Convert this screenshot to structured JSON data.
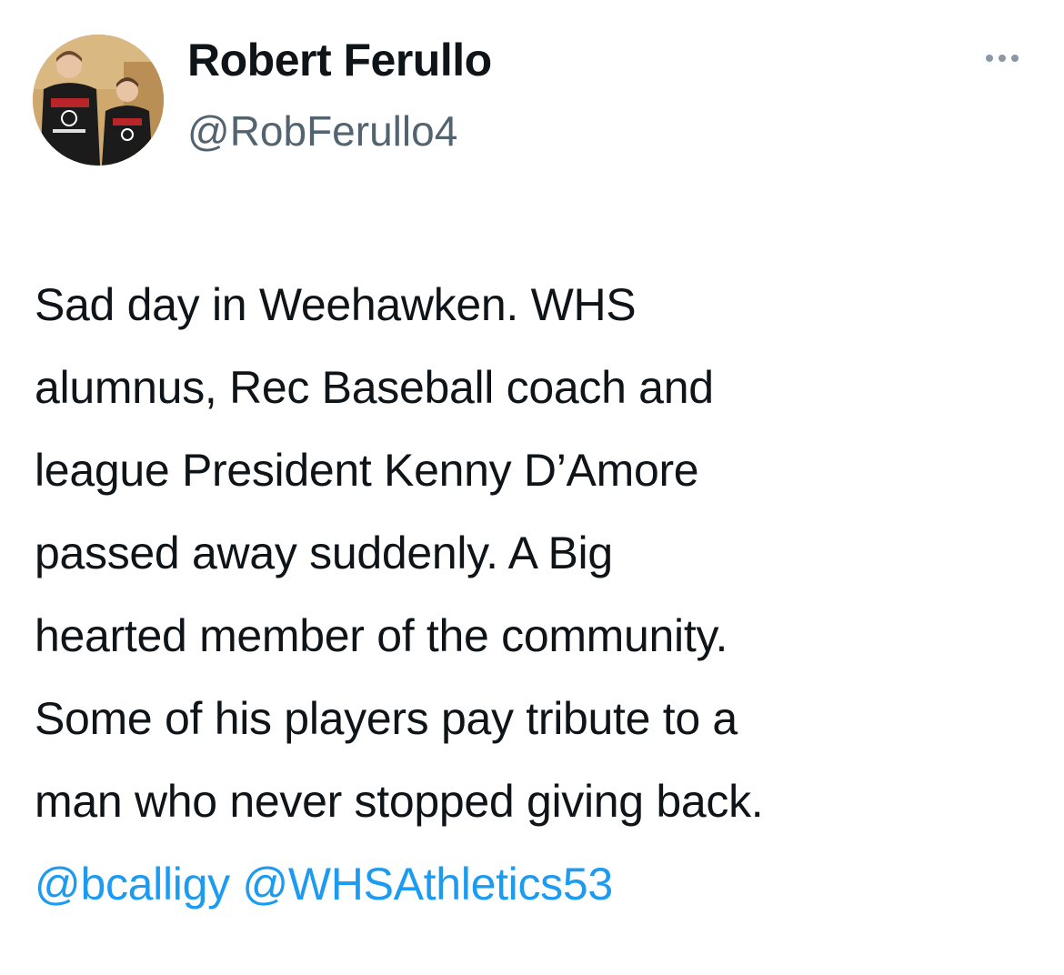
{
  "author": {
    "display_name": "Robert Ferullo",
    "handle": "@RobFerullo4",
    "avatar_icon": "profile-photo"
  },
  "menu": {
    "icon": "more-horizontal-icon"
  },
  "tweet": {
    "lines": [
      "Sad day in Weehawken. WHS",
      "alumnus, Rec Baseball coach and",
      "league President Kenny D’Amore",
      "passed away suddenly. A Big",
      "hearted member of the community.",
      "Some of his players pay tribute to a",
      "man who never stopped giving back."
    ],
    "mentions": [
      "@bcalligy",
      "@WHSAthletics53"
    ]
  },
  "colors": {
    "text": "#0f1419",
    "secondary": "#536471",
    "link": "#1d9bf0"
  }
}
